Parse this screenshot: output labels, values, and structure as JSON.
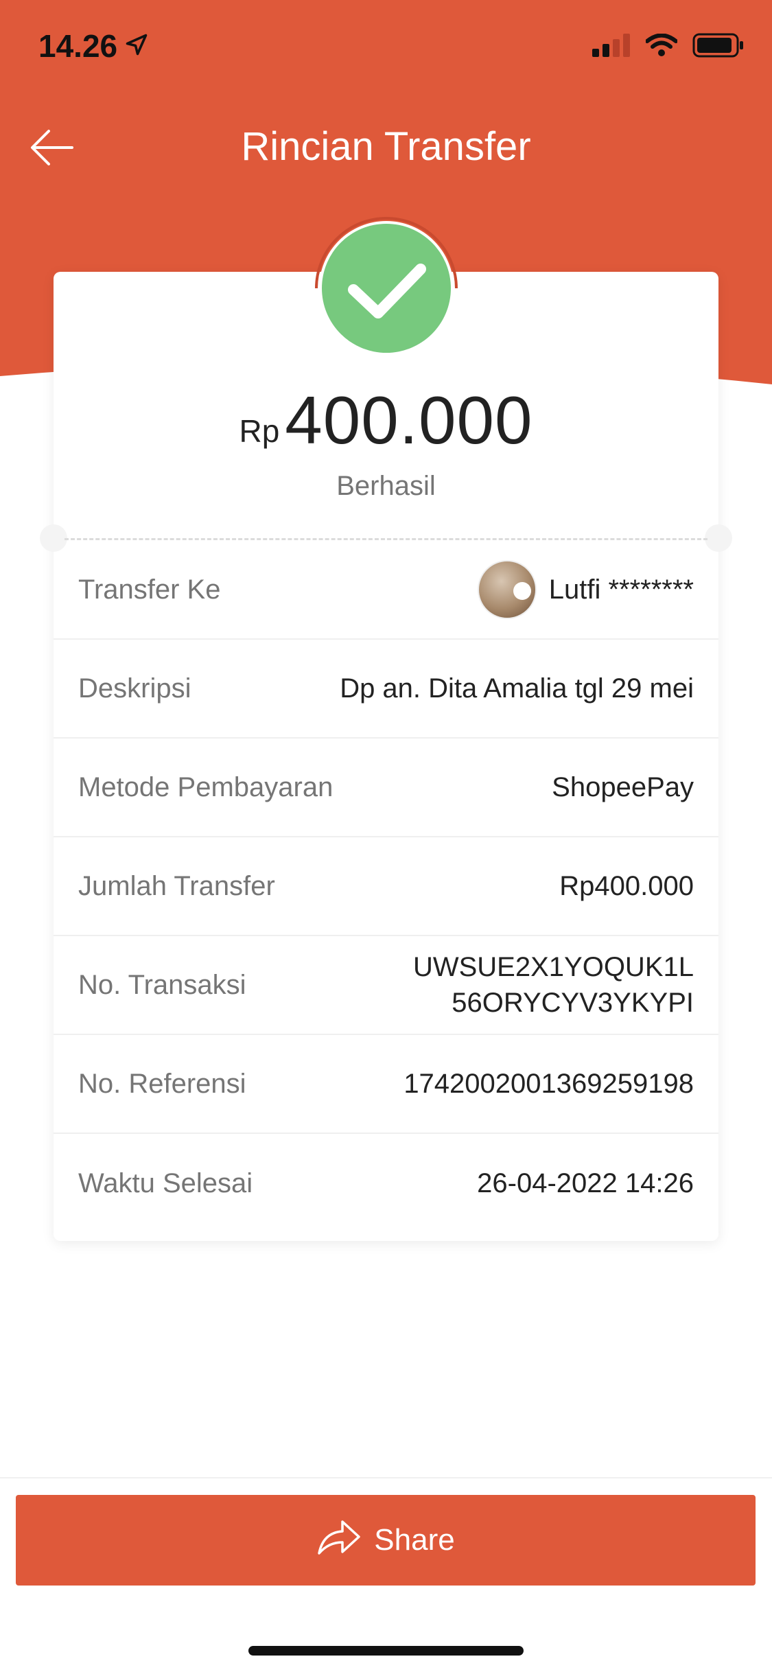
{
  "colors": {
    "accent": "#df593a",
    "success": "#77c97e",
    "text_primary": "#222222",
    "text_secondary": "#757575"
  },
  "status_bar": {
    "time": "14.26",
    "icons": [
      "location-arrow-icon",
      "cellular-signal-icon",
      "wifi-icon",
      "battery-icon"
    ]
  },
  "nav": {
    "title": "Rincian Transfer",
    "back_icon": "arrow-left-icon"
  },
  "summary": {
    "currency": "Rp",
    "amount": "400.000",
    "status": "Berhasil",
    "status_icon": "check-icon"
  },
  "details": {
    "transfer_to": {
      "label": "Transfer Ke",
      "value": "Lutfi ********"
    },
    "description": {
      "label": "Deskripsi",
      "value": "Dp an. Dita Amalia tgl 29 mei"
    },
    "payment_method": {
      "label": "Metode Pembayaran",
      "value": "ShopeePay"
    },
    "transfer_amount": {
      "label": "Jumlah Transfer",
      "value": "Rp400.000"
    },
    "transaction_no": {
      "label": "No. Transaksi",
      "value": "UWSUE2X1YOQUK1L56ORYCYV3YKYPI"
    },
    "reference_no": {
      "label": "No. Referensi",
      "value": "1742002001369259198"
    },
    "completed_time": {
      "label": "Waktu Selesai",
      "value": "26-04-2022 14:26"
    }
  },
  "footer": {
    "share_label": "Share",
    "share_icon": "share-arrow-icon"
  }
}
